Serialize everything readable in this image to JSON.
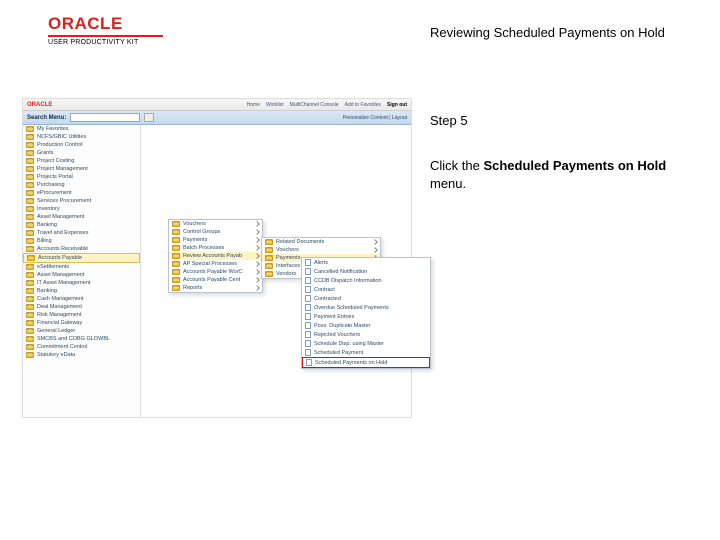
{
  "logo": {
    "brand": "ORACLE",
    "sub": "USER PRODUCTIVITY KIT"
  },
  "title": "Reviewing Scheduled Payments on Hold",
  "step_label": "Step 5",
  "instruction_pre": "Click the ",
  "instruction_bold": "Scheduled Payments on Hold",
  "instruction_post": " menu.",
  "app": {
    "topbar": {
      "brand": "ORACLE",
      "links": [
        "Home",
        "Worklist",
        "MultiChannel Console",
        "Add to Favorites",
        "Sign out"
      ]
    },
    "search": {
      "label": "Search Menu:",
      "persona": "Personalize Content | Layout"
    },
    "sidebar": [
      "My Favorites",
      "NCFS/GBIC Utilities",
      "Production Control",
      "Grants",
      "Project Costing",
      "Project Management",
      "Projects Portal",
      "Purchasing",
      "eProcurement",
      "Services Procurement",
      "Inventory",
      "Asset Management",
      "Banking",
      "Travel and Expenses",
      "Billing",
      "Accounts Receivable",
      "Accounts Payable",
      "eSettlements",
      "Asset Management",
      "IT Asset Management",
      "Banking",
      "Cash Management",
      "Deal Management",
      "Risk Management",
      "Financial Gateway",
      "General Ledger",
      "SMCBS and COBG GLOWBL",
      "Commitment Control",
      "Statutory eData"
    ],
    "sidebar_selected": 16,
    "flyout1": {
      "items": [
        "Vouchers",
        "Control Groups",
        "Payments",
        "Batch Processes",
        "Review Accounts Payab",
        "AP Special Processes",
        "Accounts Payable WorC",
        "Accounts Payable Cent",
        "Reports"
      ],
      "selected": 4
    },
    "flyout2": {
      "items": [
        "Related Documents",
        "Vouchers",
        "Payments",
        "Interfaces",
        "Vendors"
      ],
      "selected": 2
    },
    "flyout3": {
      "items": [
        "Alerts",
        "Cancelled Notification",
        "CCDB Dispatch Information",
        "Contract",
        "Contracted",
        "Overdue Scheduled Payments",
        "Payment Entries",
        "Poss. Duplicate Master",
        "Rejected Vouchers",
        "Schedule Disp. using Master",
        "Scheduled Payment",
        "Scheduled Payments on Hold"
      ],
      "highlighted": 11
    }
  }
}
